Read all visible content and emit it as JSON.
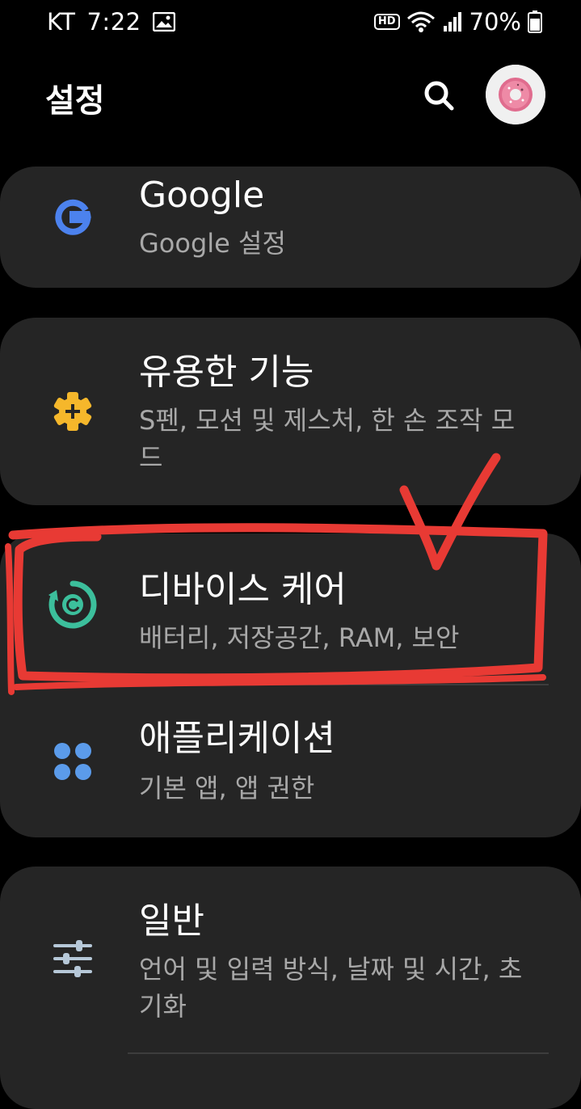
{
  "status_bar": {
    "carrier": "KT",
    "time": "7:22",
    "hd": "HD",
    "battery": "70%"
  },
  "header": {
    "title": "설정"
  },
  "items": [
    {
      "title": "Google",
      "subtitle": "Google 설정",
      "icon": "google-g-icon",
      "color": "#4c82ee"
    },
    {
      "title": "유용한 기능",
      "subtitle": "S펜, 모션 및 제스처, 한 손 조작 모드",
      "icon": "advanced-features-icon",
      "color": "#f5b72b"
    },
    {
      "title": "디바이스 케어",
      "subtitle": "배터리, 저장공간, RAM, 보안",
      "icon": "device-care-icon",
      "color": "#3cbf9c"
    },
    {
      "title": "애플리케이션",
      "subtitle": "기본 앱, 앱 권한",
      "icon": "apps-icon",
      "color": "#5b9bea"
    },
    {
      "title": "일반",
      "subtitle": "언어 및 입력 방식, 날짜 및 시간, 초기화",
      "icon": "general-management-icon",
      "color": "#b6c8d8"
    }
  ],
  "annotation_color": "#e83a34"
}
